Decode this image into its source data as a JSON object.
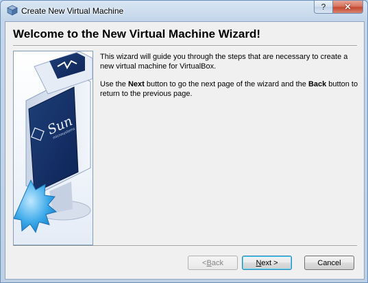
{
  "window": {
    "title": "Create New Virtual Machine",
    "help_glyph": "?",
    "close_glyph": "✕"
  },
  "wizard": {
    "heading": "Welcome to the New Virtual Machine Wizard!",
    "paragraph1": "This wizard will guide you through the steps that are necessary to create a new virtual machine for VirtualBox.",
    "paragraph2": {
      "part1": "Use the ",
      "next_word": "Next",
      "part2": " button to go the next page of the wizard and the ",
      "back_word": "Back",
      "part3": " button to return to the previous page."
    }
  },
  "image": {
    "logo_text": "Sun",
    "logo_subtext": "microsystems"
  },
  "buttons": {
    "back": {
      "prefix": "< ",
      "mnemonic": "B",
      "rest": "ack",
      "enabled": false
    },
    "next": {
      "mnemonic": "N",
      "rest": "ext >",
      "enabled": true
    },
    "cancel": {
      "label": "Cancel",
      "enabled": true
    }
  },
  "colors": {
    "accent": "#3c7fb1",
    "close": "#c4492f",
    "starburst": "#3aa8e8"
  }
}
